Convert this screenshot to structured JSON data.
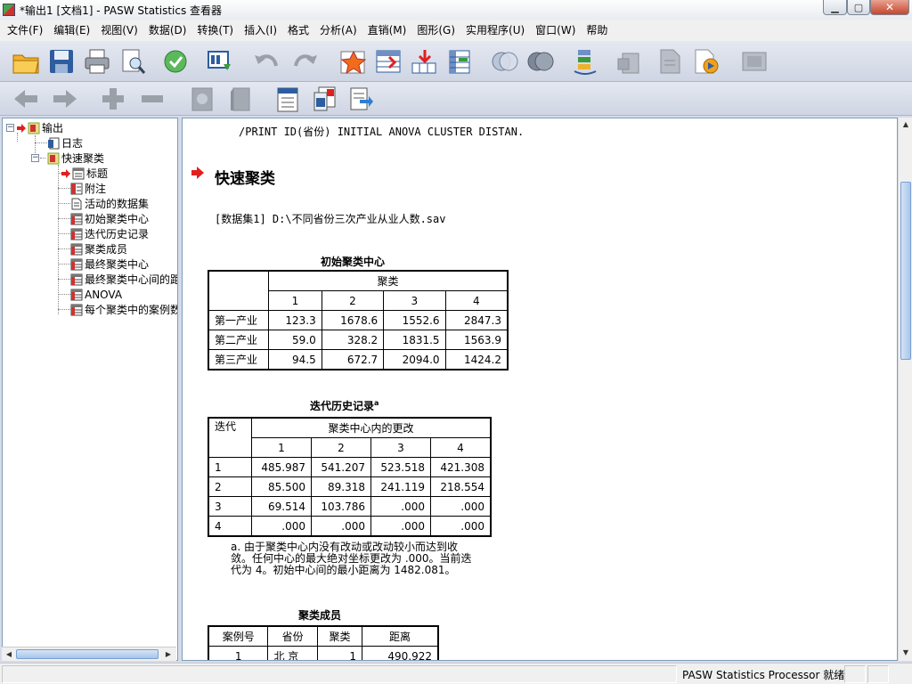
{
  "window": {
    "title": "*输出1 [文档1] - PASW Statistics 查看器"
  },
  "menu": [
    "文件(F)",
    "编辑(E)",
    "视图(V)",
    "数据(D)",
    "转换(T)",
    "插入(I)",
    "格式",
    "分析(A)",
    "直销(M)",
    "图形(G)",
    "实用程序(U)",
    "窗口(W)",
    "帮助"
  ],
  "outline": {
    "root": "输出",
    "log": "日志",
    "procedure": "快速聚类",
    "items": [
      "标题",
      "附注",
      "活动的数据集",
      "初始聚类中心",
      "迭代历史记录",
      "聚类成员",
      "最终聚类中心",
      "最终聚类中心间的距",
      "ANOVA",
      "每个聚类中的案例数"
    ]
  },
  "content": {
    "syntax": "/PRINT  ID(省份)  INITIAL  ANOVA  CLUSTER  DISTAN.",
    "section_title": "快速聚类",
    "dataset": "[数据集1]  D:\\不同省份三次产业从业人数.sav",
    "initial_centers": {
      "title": "初始聚类中心",
      "group_header": "聚类",
      "columns": [
        "1",
        "2",
        "3",
        "4"
      ],
      "rows": [
        {
          "label": "第一产业",
          "values": [
            "123.3",
            "1678.6",
            "1552.6",
            "2847.3"
          ]
        },
        {
          "label": "第二产业",
          "values": [
            "59.0",
            "328.2",
            "1831.5",
            "1563.9"
          ]
        },
        {
          "label": "第三产业",
          "values": [
            "94.5",
            "672.7",
            "2094.0",
            "1424.2"
          ]
        }
      ]
    },
    "iteration_history": {
      "title": "迭代历史记录",
      "title_sup": "a",
      "row_header": "迭代",
      "group_header": "聚类中心内的更改",
      "columns": [
        "1",
        "2",
        "3",
        "4"
      ],
      "rows": [
        {
          "label": "1",
          "values": [
            "485.987",
            "541.207",
            "523.518",
            "421.308"
          ]
        },
        {
          "label": "2",
          "values": [
            "85.500",
            "89.318",
            "241.119",
            "218.554"
          ]
        },
        {
          "label": "3",
          "values": [
            "69.514",
            "103.786",
            ".000",
            ".000"
          ]
        },
        {
          "label": "4",
          "values": [
            ".000",
            ".000",
            ".000",
            ".000"
          ]
        }
      ],
      "footnote_lines": [
        "a. 由于聚类中心内没有改动或改动较小而达到收",
        "敛。任何中心的最大绝对坐标更改为 .000。当前迭",
        "代为 4。初始中心间的最小距离为 1482.081。"
      ]
    },
    "membership": {
      "title": "聚类成员",
      "headers": [
        "案例号",
        "省份",
        "聚类",
        "距离"
      ],
      "rows": [
        {
          "case": "1",
          "province": "北 京",
          "cluster": "1",
          "distance": "490.922"
        }
      ]
    }
  },
  "status": {
    "text": "PASW Statistics Processor 就绪"
  },
  "colors": {
    "accent_red": "#e02020",
    "toolbar_bg": "#d6dbe9",
    "thumb_blue": "#a9c5ea"
  }
}
